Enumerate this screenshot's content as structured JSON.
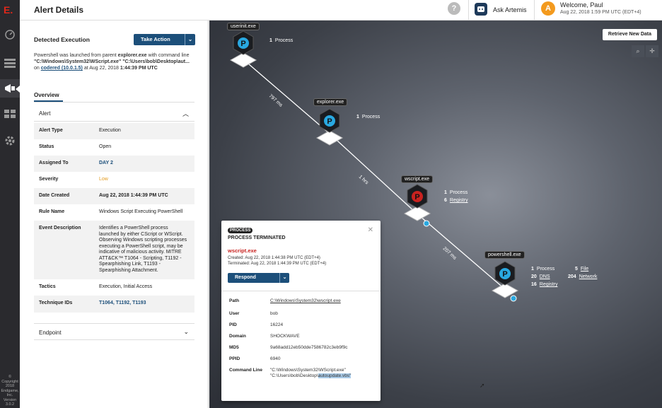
{
  "app": {
    "logo": "E.",
    "copyright": "© Copyright 2018 Endgame, Inc. Version 3.0.2"
  },
  "header": {
    "title": "Alert Details",
    "help": "?",
    "ask": "Ask Artemis",
    "avatar": "A",
    "welcome": "Welcome, Paul",
    "datetime": "Aug 22, 2018 1:59 PM UTC (EDT+4)"
  },
  "detection": {
    "title": "Detected Execution",
    "action_label": "Take Action",
    "desc_1": "Powershell was launched from parent ",
    "parent": "explorer.exe",
    "desc_2": " with command line",
    "cmd": "\"C:\\Windows\\System32\\WScript.exe\" \"C:\\Users\\bob\\Desktop\\aut...",
    "on": "on",
    "host": "codered (10.0.1.5)",
    "at": "at Aug 22, 2018",
    "time": "1:44:39 PM UTC"
  },
  "tabs": {
    "overview": "Overview"
  },
  "alert": {
    "section": "Alert",
    "rows": [
      {
        "k": "Alert Type",
        "v": "Execution"
      },
      {
        "k": "Status",
        "v": "Open"
      },
      {
        "k": "Assigned To",
        "v": "DAY 2"
      },
      {
        "k": "Severity",
        "v": "Low"
      },
      {
        "k": "Date Created",
        "v": "Aug 22, 2018 1:44:39 PM UTC"
      },
      {
        "k": "Rule Name",
        "v": "Windows Script Executing PowerShell"
      },
      {
        "k": "Event Description",
        "v": "Identifies a PowerShell process launched by either CScript or WScript. Observing Windows scripting processes executing a PowerShell script, may be indicative of malicious activity. MITRE ATT&CK™ T1064 - Scripting, T1192 - Spearphishing Link, T1193 - Spearphishing Attachment."
      },
      {
        "k": "Tactics",
        "v": "Execution, Initial Access"
      },
      {
        "k": "Technique IDs",
        "v": "T1064, T1192, T1193"
      }
    ],
    "endpoint": "Endpoint"
  },
  "graph": {
    "retrieve": "Retrieve New Data",
    "nodes": [
      {
        "name": "userinit.exe",
        "process": "1",
        "process_label": "Process"
      },
      {
        "name": "explorer.exe",
        "process": "1",
        "process_label": "Process"
      },
      {
        "name": "wscript.exe",
        "process": "1",
        "process_label": "Process",
        "registry": "6",
        "registry_label": "Registry"
      },
      {
        "name": "powershell.exe",
        "process": "1",
        "process_label": "Process",
        "file": "5",
        "file_label": "File",
        "dns": "20",
        "dns_label": "DNS",
        "network": "204",
        "network_label": "Network",
        "registry": "16",
        "registry_label": "Registry"
      }
    ],
    "edges": [
      "797 ms",
      "1 hrs",
      "207 ms"
    ]
  },
  "popup": {
    "badge": "PROCESS",
    "state": "PROCESS TERMINATED",
    "name": "wscript.exe",
    "created": "Created: Aug 22, 2018 1:44:38 PM UTC (EDT+4)",
    "terminated": "Terminated: Aug 22, 2018 1:44:39 PM UTC (EDT+4)",
    "respond": "Respond",
    "path_k": "Path",
    "path": "C:\\Windows\\System32\\wscript.exe",
    "user_k": "User",
    "user": "bob",
    "pid_k": "PID",
    "pid": "16224",
    "domain_k": "Domain",
    "domain": "SHOCKWAVE",
    "md5_k": "MD5",
    "md5": "9a68add12eb50dde7586782c3eb9f9c",
    "ppid_k": "PPID",
    "ppid": "6940",
    "cmd_k": "Command Line",
    "cmd_a": "\"C:\\Windows\\System32\\WScript.exe\" \"C:\\Users\\bob\\Desktop\\",
    "cmd_b": "autoupdate.vbs\""
  }
}
